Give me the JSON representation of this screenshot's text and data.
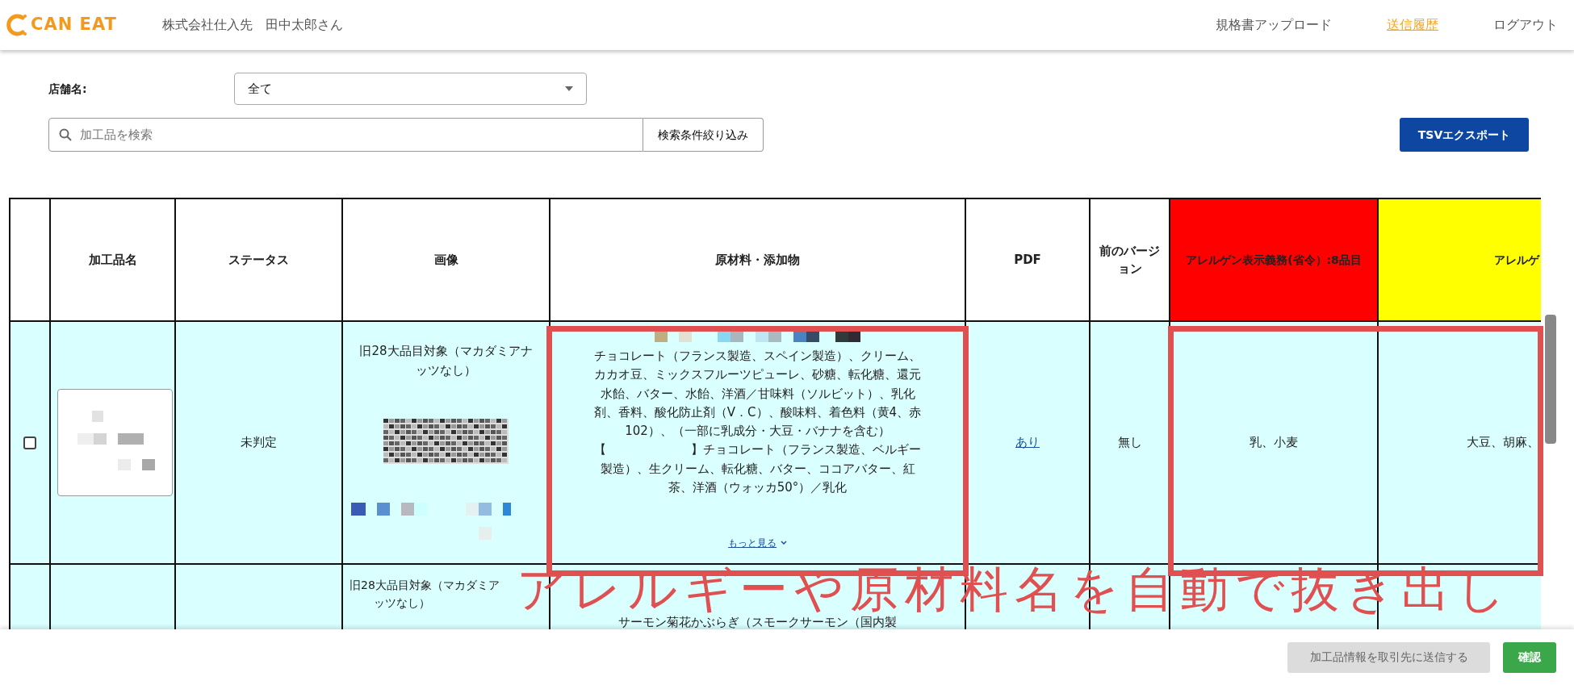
{
  "header": {
    "logo": "CAN EAT",
    "company": "株式会社仕入先",
    "user": "田中太郎さん",
    "nav": [
      {
        "label": "規格書アップロード",
        "selected": false
      },
      {
        "label": "送信履歴",
        "selected": true
      },
      {
        "label": "ログアウト",
        "selected": false
      }
    ]
  },
  "filters": {
    "store_label": "店舗名:",
    "store_select": "全て",
    "search": {
      "placeholder": "加工品を検索"
    },
    "filter_button": "検索条件絞り込み",
    "export_button": "TSVエクスポート"
  },
  "table": {
    "columns": [
      {
        "label": "加工品名"
      },
      {
        "label": "ステータス"
      },
      {
        "label": "画像"
      },
      {
        "label": "原材料・添加物"
      },
      {
        "label": "PDF"
      },
      {
        "label": "前のバージョン"
      },
      {
        "label": "アレルゲン表示義務(省令）:8品目",
        "color": "#ff0000"
      },
      {
        "label": "アレルゲ",
        "color": "#ffff00"
      }
    ],
    "rows": [
      {
        "checked": false,
        "status": "未判定",
        "image_caption": [
          "旧28大品目対象（マカダミアナ",
          "ッツなし）"
        ],
        "ingredients": "チョコレート（フランス製造、スペイン製造）、クリーム、カカオ豆、ミックスフルーツピューレ、砂糖、転化糖、還元水飴、バター、水飴、洋酒／甘味料（ソルビット）、乳化剤、香料、酸化防止剤（V．C）、酸味料、着色料（黄4、赤102）、（一部に乳成分・大豆・バナナを含む）【　　　　　　　】チョコレート（フランス製造、ベルギー製造）、生クリーム、転化糖、バター、ココアバター、紅茶、洋酒（ウォッカ50°）／乳化",
        "more_link": "もっと見る",
        "pdf": "あり",
        "previous_version": "無し",
        "allergens_mandatory": "乳、小麦",
        "allergens_recommended": "大豆、胡麻、"
      },
      {
        "image_caption": [
          "旧28大品目対象（マカダミア",
          "ッツなし）"
        ],
        "ingredients": "サーモン菊花かぶらぎ（スモークサーモン（国内製"
      }
    ]
  },
  "footer": {
    "buttons": [
      {
        "label": "加工品情報を取引先に送信する",
        "disabled": true
      },
      {
        "label": "確認",
        "disabled": false
      }
    ]
  },
  "annotation": {
    "text": "アレルギーや原材料名を自動で抜き出し"
  }
}
